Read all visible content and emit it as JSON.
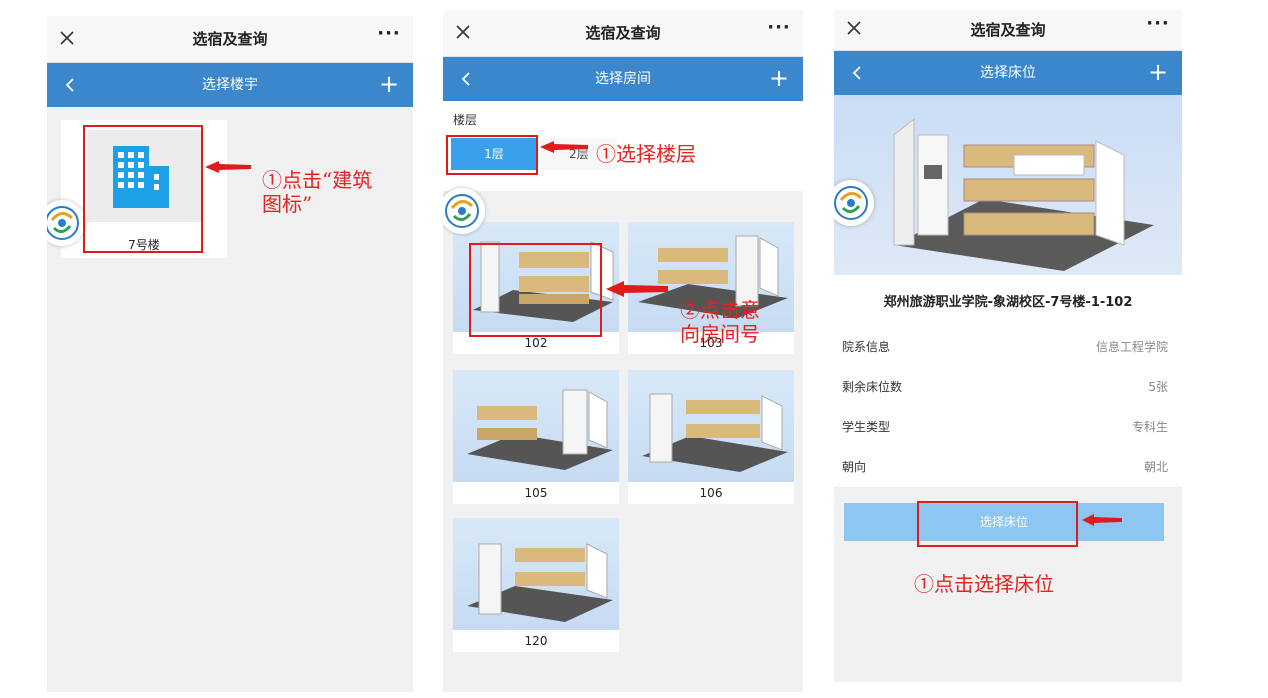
{
  "window_title": "选宿及查询",
  "colors": {
    "nav_blue": "#3a87cc",
    "annotation_red": "#e01b1b",
    "floor_active": "#3aa0ec",
    "bed_button": "#8ec6f2"
  },
  "screen1": {
    "nav_title": "选择楼宇",
    "building_label": "7号楼",
    "annotation": "①点击“建筑\n图标”"
  },
  "screen2": {
    "nav_title": "选择房间",
    "floor_section_label": "楼层",
    "floors": [
      "1层",
      "2层"
    ],
    "rooms": [
      "102",
      "103",
      "105",
      "106",
      "120"
    ],
    "annotation_floor": "①选择楼层",
    "annotation_room": "②点击意\n向房间号"
  },
  "screen3": {
    "nav_title": "选择床位",
    "room_title": "郑州旅游职业学院-象湖校区-7号楼-1-102",
    "info": [
      {
        "key": "院系信息",
        "value": "信息工程学院"
      },
      {
        "key": "剩余床位数",
        "value": "5张"
      },
      {
        "key": "学生类型",
        "value": "专科生"
      },
      {
        "key": "朝向",
        "value": "朝北"
      }
    ],
    "select_bed_button": "选择床位",
    "annotation": "①点击选择床位"
  },
  "icons": {
    "close": "close-icon",
    "more": "more-icon",
    "back": "back-chevron-icon",
    "add": "plus-icon",
    "building": "building-icon",
    "school_logo": "school-logo-icon"
  }
}
